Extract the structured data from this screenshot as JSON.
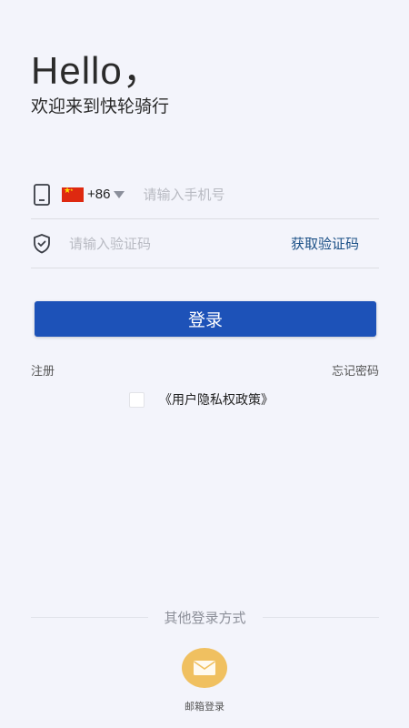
{
  "header": {
    "greeting": "Hello，",
    "welcome": "欢迎来到快轮骑行"
  },
  "phone_row": {
    "dial_code": "+86",
    "placeholder": "请输入手机号"
  },
  "code_row": {
    "placeholder": "请输入验证码",
    "get_code_label": "获取验证码"
  },
  "login_button": "登录",
  "links": {
    "register": "注册",
    "forgot_password": "忘记密码"
  },
  "agreement": {
    "checked": false,
    "policy_link": "《用户隐私权政策》"
  },
  "other_login": {
    "divider_label": "其他登录方式",
    "email_label": "邮箱登录"
  },
  "colors": {
    "primary": "#1d52b8",
    "link": "#1a4f86",
    "mail_button": "#f0c060",
    "background": "#f3f4fb"
  },
  "icons": [
    "phone-icon",
    "china-flag-icon",
    "dropdown-triangle-icon",
    "shield-check-icon",
    "mail-icon"
  ]
}
